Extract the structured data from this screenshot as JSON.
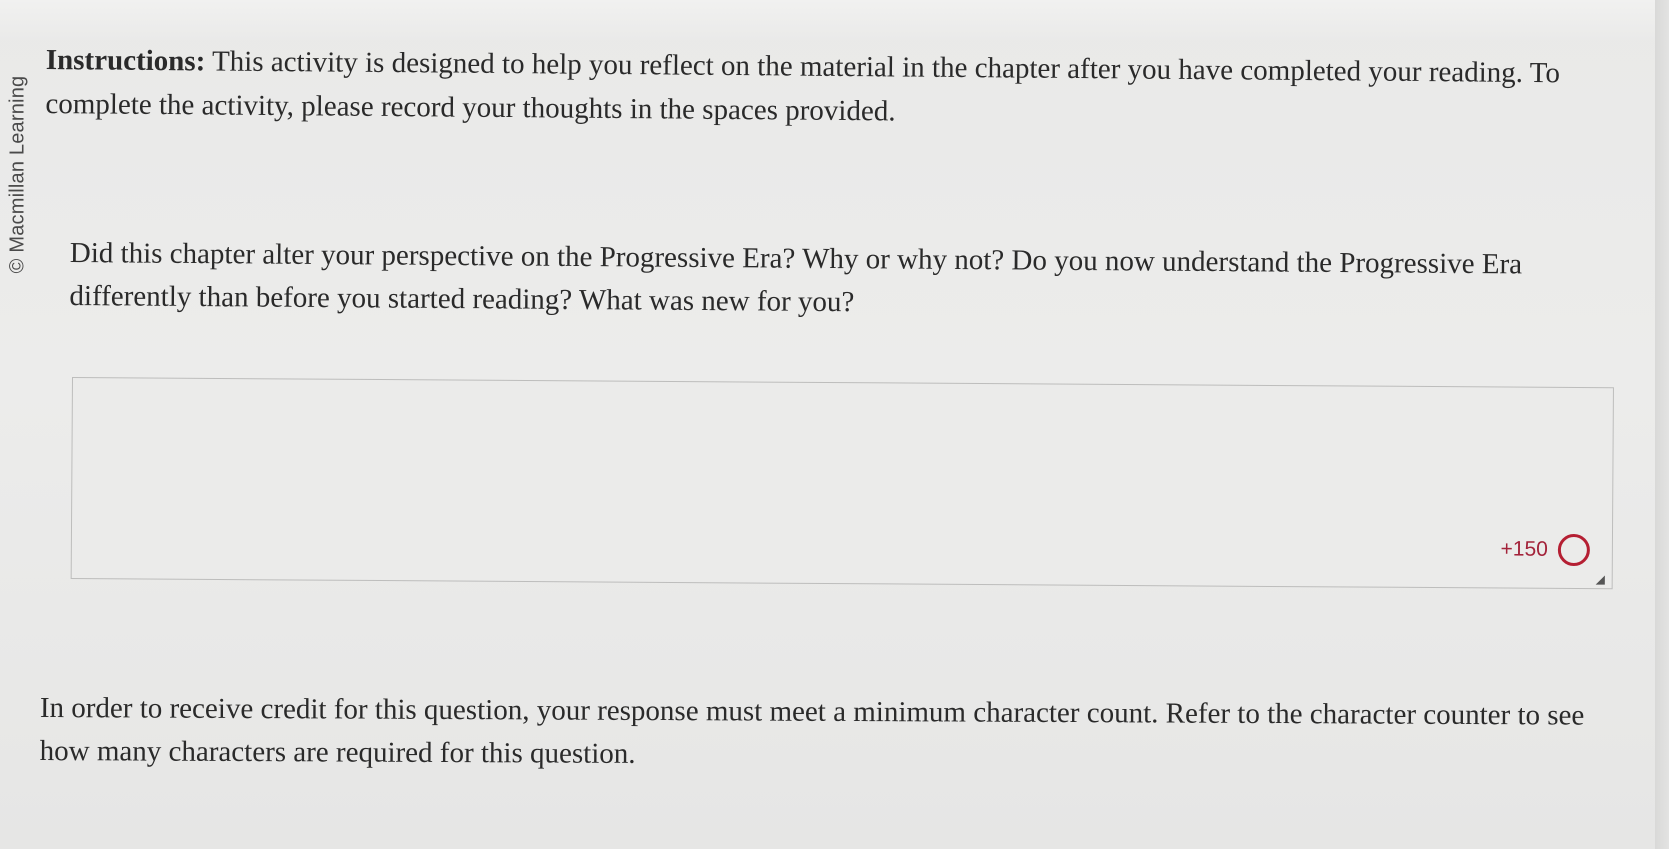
{
  "watermark": {
    "text": "© Macmillan Learning"
  },
  "instructions": {
    "label": "Instructions:",
    "text": " This activity is designed to help you reflect on the material in the chapter after you have completed your reading. To complete the activity, please record your thoughts in the spaces provided."
  },
  "question": {
    "text": "Did this chapter alter your perspective on the Progressive Era? Why or why not? Do you now understand the Progressive Era differently than before you started reading? What was new for you?"
  },
  "answer_box": {
    "value": "",
    "counter": "+150"
  },
  "credit_note": {
    "text": "In order to receive credit for this question, your response must meet a minimum character count. Refer to the character counter to see how many characters are required for this question."
  },
  "colors": {
    "counter_red": "#b51f33",
    "page_background": "#ebebea"
  },
  "icons": {
    "counter": "character-counter-ring-icon",
    "resize": "resize-handle-icon"
  }
}
